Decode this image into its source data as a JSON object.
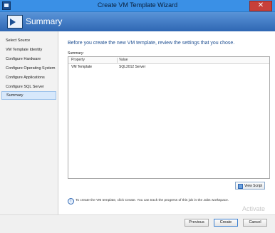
{
  "window": {
    "title": "Create VM Template Wizard",
    "close_glyph": "✕"
  },
  "header": {
    "title": "Summary"
  },
  "sidebar": {
    "items": [
      {
        "label": "Select Source"
      },
      {
        "label": "VM Template Identity"
      },
      {
        "label": "Configure Hardware"
      },
      {
        "label": "Configure Operating System"
      },
      {
        "label": "Configure Applications"
      },
      {
        "label": "Configure SQL Server"
      },
      {
        "label": "Summary",
        "active": true
      }
    ]
  },
  "main": {
    "heading": "Before you create the new VM template, review the settings that you chose.",
    "summary_label": "Summary:",
    "table": {
      "columns": [
        "Property",
        "Value"
      ],
      "rows": [
        {
          "property": "VM Template",
          "value": "SQL2012 Server"
        }
      ]
    },
    "view_script_label": "View Script",
    "info_text": "To create the VM template, click Create.  You can track the progress of this job in the Jobs workspace."
  },
  "footer": {
    "previous_label": "Previous",
    "create_label": "Create",
    "cancel_label": "Cancel"
  },
  "watermark": "Activate"
}
